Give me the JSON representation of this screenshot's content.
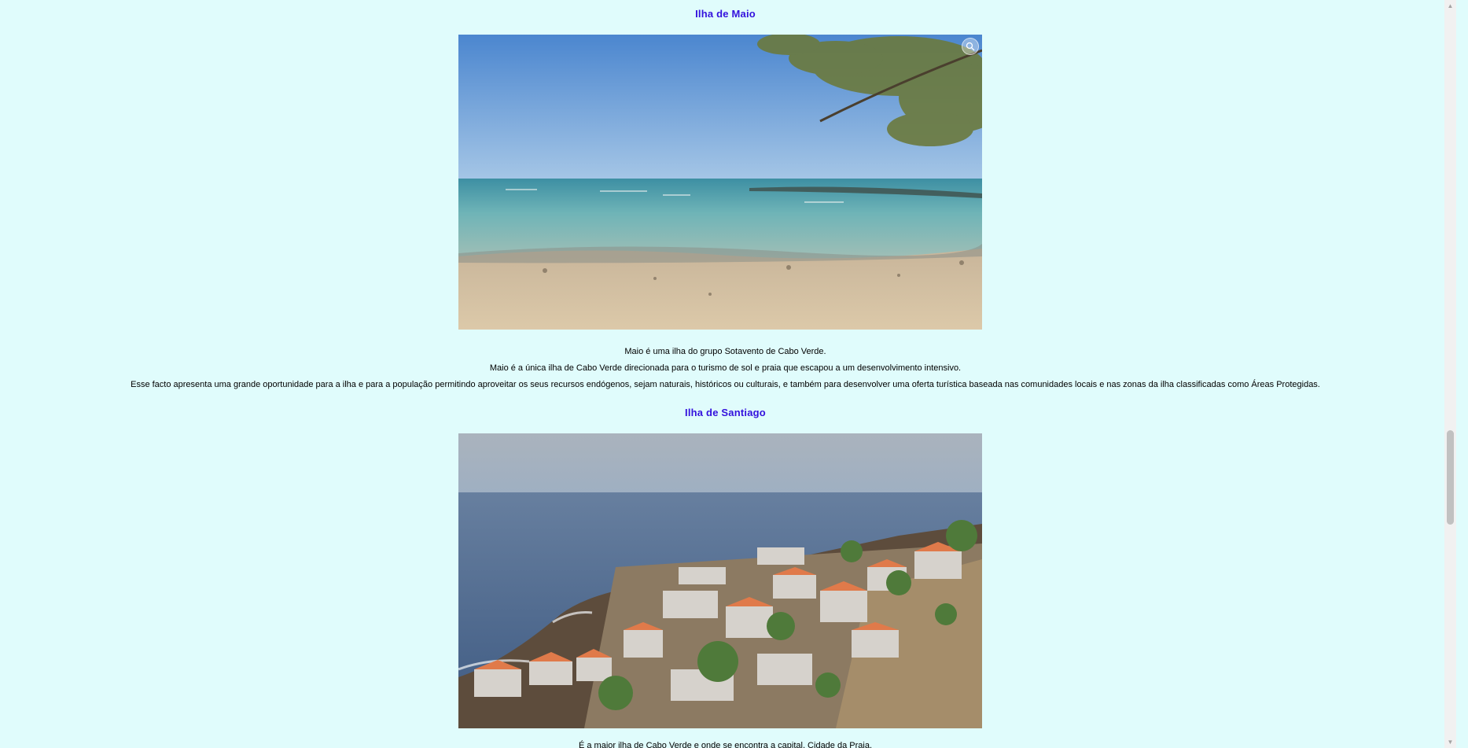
{
  "sections": [
    {
      "title": "Ilha de Maio",
      "image_alt": "Praia na ilha de Maio",
      "paragraphs": [
        "Maio é uma ilha do grupo Sotavento de Cabo Verde.",
        "Maio é a única ilha de Cabo Verde direcionada para o turismo de sol e praia que escapou a um desenvolvimento intensivo.",
        "Esse facto apresenta uma grande oportunidade para a ilha e para a população permitindo aproveitar os seus recursos endógenos, sejam naturais, históricos ou culturais, e também para desenvolver uma oferta turística baseada nas comunidades locais e nas zonas da ilha classificadas como Áreas Protegidas."
      ]
    },
    {
      "title": "Ilha de Santiago",
      "image_alt": "Vila costeira na ilha de Santiago",
      "cut_text": "É a maior ilha de Cabo Verde e onde se encontra a capital, Cidade da Praia."
    }
  ],
  "icons": {
    "zoom": "zoom-icon",
    "scroll_up": "scroll-up-arrow-icon",
    "scroll_down": "scroll-down-arrow-icon"
  },
  "colors": {
    "background": "#e0fcfc",
    "heading": "#3311dd",
    "text": "#000000"
  }
}
